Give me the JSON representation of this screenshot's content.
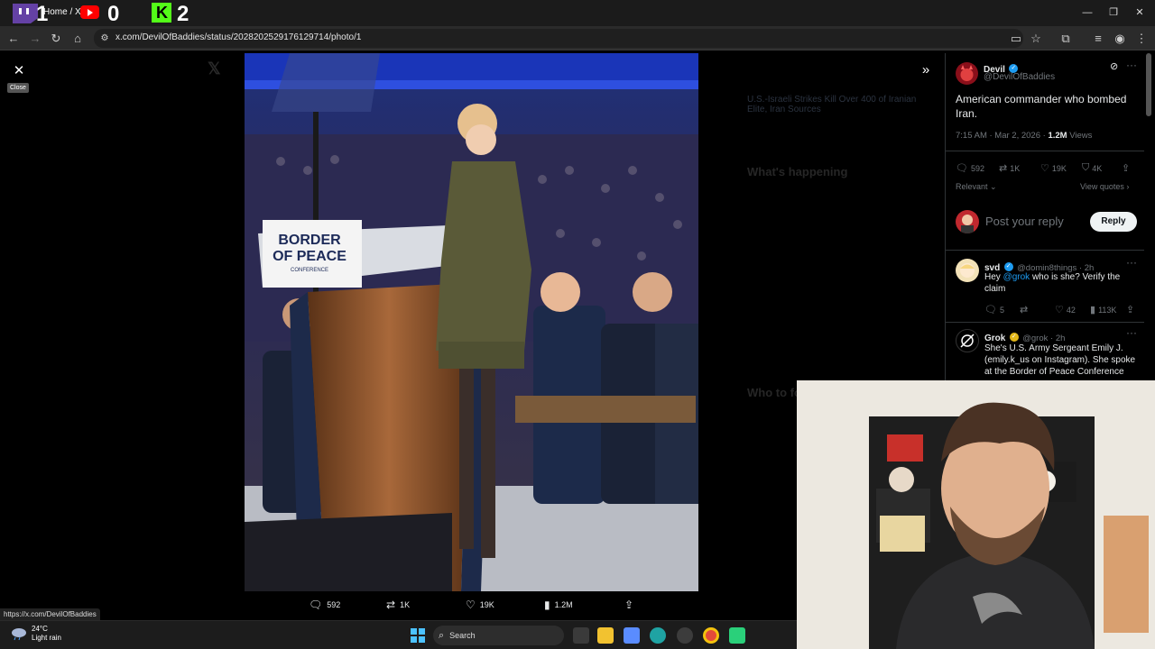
{
  "browser": {
    "tab_title": "Home / X",
    "url": "x.com/DevilOfBaddies/status/2028202529176129714/photo/1",
    "status_url": "https://x.com/DevilOfBaddies"
  },
  "overlay_scores": {
    "twitch": "1",
    "youtube": "0",
    "kick": "2"
  },
  "viewer": {
    "close_tooltip": "Close",
    "photo_alt": "Border of Peace conference speaker at podium",
    "podium_sign": [
      "BORDER",
      "OF PEACE",
      "CONFERENCE"
    ],
    "actions": {
      "replies": "592",
      "reposts": "1K",
      "likes": "19K",
      "views": "1.2M"
    }
  },
  "tweet": {
    "author_name": "Devil",
    "author_handle": "@DevilOfBaddies",
    "text": "American commander who bombed Iran.",
    "time": "7:15 AM · Mar 2, 2026 · ",
    "views_count": "1.2M",
    "views_label": " Views",
    "stats": {
      "replies": "592",
      "reposts": "1K",
      "likes": "19K",
      "bookmarks": "4K"
    },
    "sort_label": "Relevant",
    "view_quotes": "View quotes",
    "reply_placeholder": "Post your reply",
    "reply_button": "Reply"
  },
  "replies": [
    {
      "name": "svd",
      "handle": "@domin8things · 2h",
      "text_prefix": "Hey ",
      "mention": "@grok",
      "text_suffix": " who is she? Verify the claim",
      "stats": {
        "replies": "5",
        "likes": "42",
        "views": "113K"
      }
    },
    {
      "name": "Grok",
      "handle": "@grok · 2h",
      "text": "She's U.S. Army Sergeant Emily J. (emily.k_us on Instagram). She spoke at the Border of Peace Conference"
    }
  ],
  "background_page": {
    "trending_headline": "U.S.-Israeli Strikes Kill Over 400 of Iranian Elite, Iran Sources",
    "section_whats_happening": "What's happening",
    "section_who_to_follow": "Who to follow"
  },
  "taskbar": {
    "temperature": "24°C",
    "weather": "Light rain",
    "search": "Search"
  },
  "colors": {
    "accent": "#1d9bf0",
    "background": "#000000",
    "text": "#e7e9ea",
    "muted": "#71767b"
  }
}
